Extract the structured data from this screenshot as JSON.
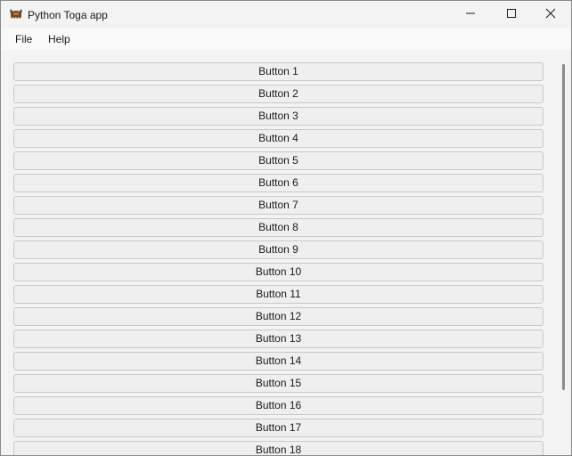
{
  "window": {
    "title": "Python Toga app",
    "icon": "toga-bison-icon"
  },
  "controls": {
    "minimize": "minimize-icon",
    "maximize": "maximize-icon",
    "close": "close-icon"
  },
  "menu": {
    "file": "File",
    "help": "Help"
  },
  "buttons": [
    "Button 1",
    "Button 2",
    "Button 3",
    "Button 4",
    "Button 5",
    "Button 6",
    "Button 7",
    "Button 8",
    "Button 9",
    "Button 10",
    "Button 11",
    "Button 12",
    "Button 13",
    "Button 14",
    "Button 15",
    "Button 16",
    "Button 17",
    "Button 18"
  ],
  "colors": {
    "window_bg": "#f3f3f3",
    "button_bg": "#efefef",
    "button_border": "#c8c8c8",
    "scrollbar": "#8a8a8a"
  }
}
